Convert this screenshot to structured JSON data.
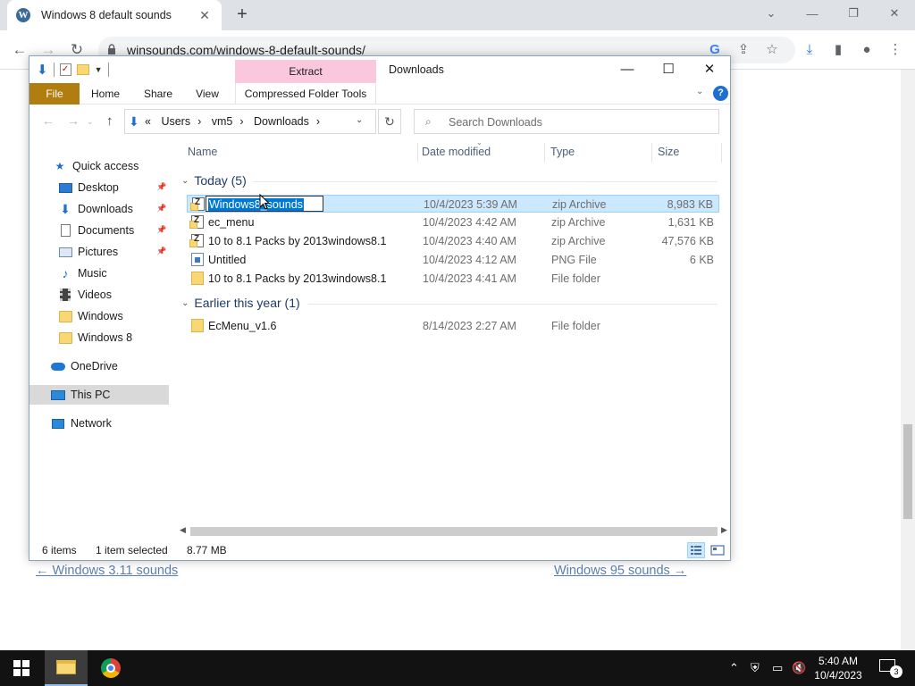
{
  "browser": {
    "tab_title": "Windows 8 default sounds",
    "favicon_letter": "W",
    "url": "winsounds.com/windows-8-default-sounds/"
  },
  "webpage": {
    "prev_link": "← Windows 3.11 sounds",
    "next_link": "Windows 95 sounds →"
  },
  "explorer": {
    "window_title": "Downloads",
    "contextual_tab": "Extract",
    "ribbon_tabs": [
      "File",
      "Home",
      "Share",
      "View",
      "Compressed Folder Tools"
    ],
    "address": {
      "overflow": "«",
      "crumbs": [
        "Users",
        "vm5",
        "Downloads"
      ]
    },
    "search_placeholder": "Search Downloads",
    "nav": [
      {
        "label": "Quick access",
        "icon": "star-icon"
      },
      {
        "label": "Desktop",
        "icon": "desktop-icon",
        "pinned": true
      },
      {
        "label": "Downloads",
        "icon": "download-arrow-icon",
        "pinned": true
      },
      {
        "label": "Documents",
        "icon": "document-icon",
        "pinned": true
      },
      {
        "label": "Pictures",
        "icon": "pictures-icon",
        "pinned": true
      },
      {
        "label": "Music",
        "icon": "music-note-icon"
      },
      {
        "label": "Videos",
        "icon": "film-icon"
      },
      {
        "label": "Windows",
        "icon": "folder-icon"
      },
      {
        "label": "Windows 8",
        "icon": "folder-icon"
      },
      {
        "label": "OneDrive",
        "icon": "cloud-icon"
      },
      {
        "label": "This PC",
        "icon": "computer-icon",
        "selected": true
      },
      {
        "label": "Network",
        "icon": "network-icon"
      }
    ],
    "columns": [
      "Name",
      "Date modified",
      "Type",
      "Size"
    ],
    "groups": [
      {
        "title": "Today (5)",
        "rows": [
          {
            "name": "Windows8_sounds",
            "date": "10/4/2023 5:39 AM",
            "type": "zip Archive",
            "size": "8,983 KB",
            "icon": "zip-icon",
            "selected": true,
            "renaming": true
          },
          {
            "name": "ec_menu",
            "date": "10/4/2023 4:42 AM",
            "type": "zip Archive",
            "size": "1,631 KB",
            "icon": "zip-icon"
          },
          {
            "name": "10 to 8.1 Packs by 2013windows8.1",
            "date": "10/4/2023 4:40 AM",
            "type": "zip Archive",
            "size": "47,576 KB",
            "icon": "zip-icon"
          },
          {
            "name": "Untitled",
            "date": "10/4/2023 4:12 AM",
            "type": "PNG File",
            "size": "6 KB",
            "icon": "png-icon"
          },
          {
            "name": "10 to 8.1 Packs by 2013windows8.1",
            "date": "10/4/2023 4:41 AM",
            "type": "File folder",
            "size": "",
            "icon": "folder-icon"
          }
        ]
      },
      {
        "title": "Earlier this year (1)",
        "rows": [
          {
            "name": "EcMenu_v1.6",
            "date": "8/14/2023 2:27 AM",
            "type": "File folder",
            "size": "",
            "icon": "folder-icon"
          }
        ]
      }
    ],
    "status": {
      "items": "6 items",
      "selected": "1 item selected",
      "size": "8.77 MB"
    }
  },
  "taskbar": {
    "time": "5:40 AM",
    "date": "10/4/2023",
    "notifications": "3"
  }
}
